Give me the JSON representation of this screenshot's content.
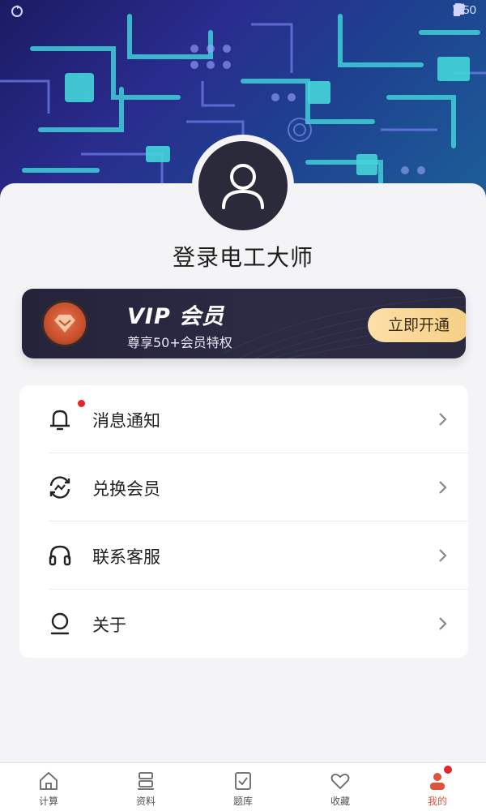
{
  "status_bar": {
    "time": "3:50"
  },
  "profile": {
    "login_title": "登录电工大师"
  },
  "vip": {
    "title": "VIP 会员",
    "subtitle": "尊享50+会员特权",
    "button_label": "立即开通",
    "accent": "#f6cf85"
  },
  "menu": {
    "items": [
      {
        "label": "消息通知",
        "icon": "bell-icon",
        "has_dot": true
      },
      {
        "label": "兑换会员",
        "icon": "exchange-icon",
        "has_dot": false
      },
      {
        "label": "联系客服",
        "icon": "headset-icon",
        "has_dot": false
      },
      {
        "label": "关于",
        "icon": "about-icon",
        "has_dot": false
      }
    ]
  },
  "tabbar": {
    "active_color": "#e0533a",
    "tabs": [
      {
        "label": "计算",
        "icon": "home-icon",
        "active": false
      },
      {
        "label": "资料",
        "icon": "stack-icon",
        "active": false
      },
      {
        "label": "题库",
        "icon": "checklist-icon",
        "active": false
      },
      {
        "label": "收藏",
        "icon": "heart-icon",
        "active": false
      },
      {
        "label": "我的",
        "icon": "person-icon",
        "active": true
      }
    ]
  }
}
